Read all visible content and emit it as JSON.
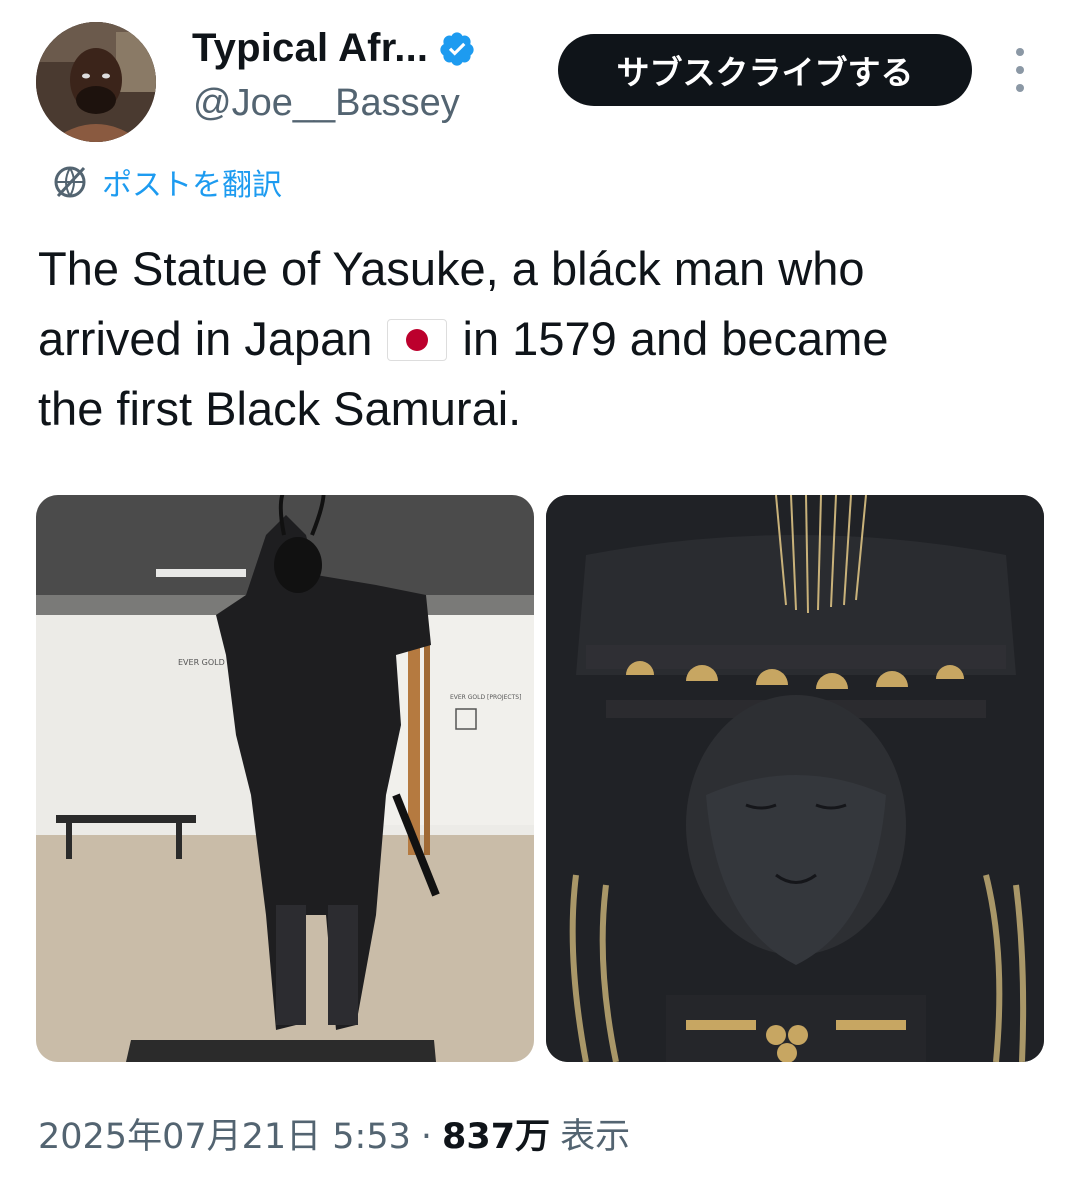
{
  "author": {
    "display_name": "Typical Afr...",
    "handle": "@Joe__Bassey",
    "verified": true,
    "verified_color": "#1d9bf0"
  },
  "subscribe_label": "サブスクライブする",
  "translate_label": "ポストを翻訳",
  "tweet": {
    "line1": "The Statue of Yasuke, a bláck man who",
    "line2_before_flag": "arrived in Japan",
    "flag_icon": "japan-flag-icon",
    "line2_after_flag": "in 1579 and became",
    "line3": "the first Black Samurai."
  },
  "media": {
    "left_gallery_sign_1": "EVER GOLD [PROJECTS]",
    "left_gallery_sign_2": "EVER GOLD [PROJECTS]"
  },
  "footer": {
    "timestamp": "2025年07月21日 5:53",
    "separator": "·",
    "views": "837万",
    "views_label": "表示"
  },
  "colors": {
    "accent": "#1d9bf0",
    "text": "#0f1419",
    "muted": "#536471"
  }
}
